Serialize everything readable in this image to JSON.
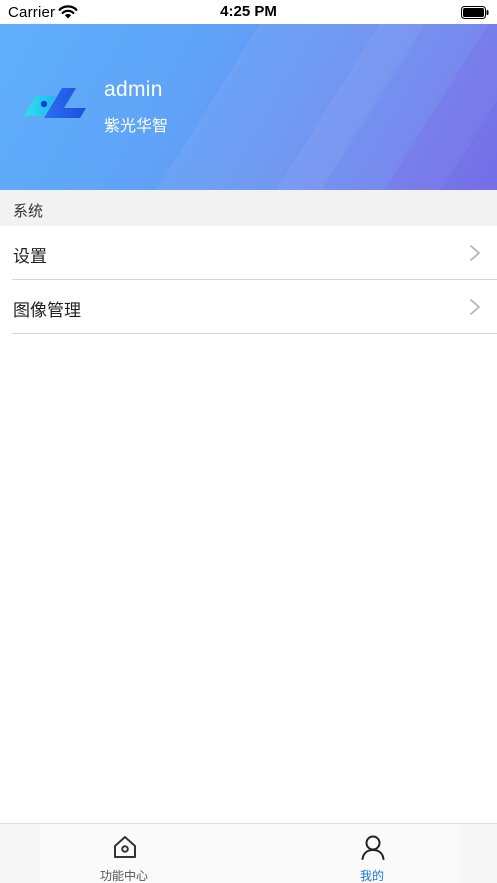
{
  "status_bar": {
    "carrier": "Carrier",
    "time": "4:25 PM"
  },
  "profile": {
    "username": "admin",
    "organization": "紫光华智"
  },
  "section": {
    "title": "系统"
  },
  "menu": {
    "items": [
      {
        "label": "设置"
      },
      {
        "label": "图像管理"
      }
    ]
  },
  "tab_bar": {
    "tabs": [
      {
        "label": "功能中心",
        "icon": "home-icon",
        "active": false
      },
      {
        "label": "我的",
        "icon": "user-icon",
        "active": true
      }
    ]
  },
  "colors": {
    "header_gradient_start": "#5fb0fb",
    "header_gradient_end": "#7673e8",
    "active_tab": "#1a73e8",
    "inactive_tab": "#555555",
    "section_background": "#f2f2f2"
  }
}
